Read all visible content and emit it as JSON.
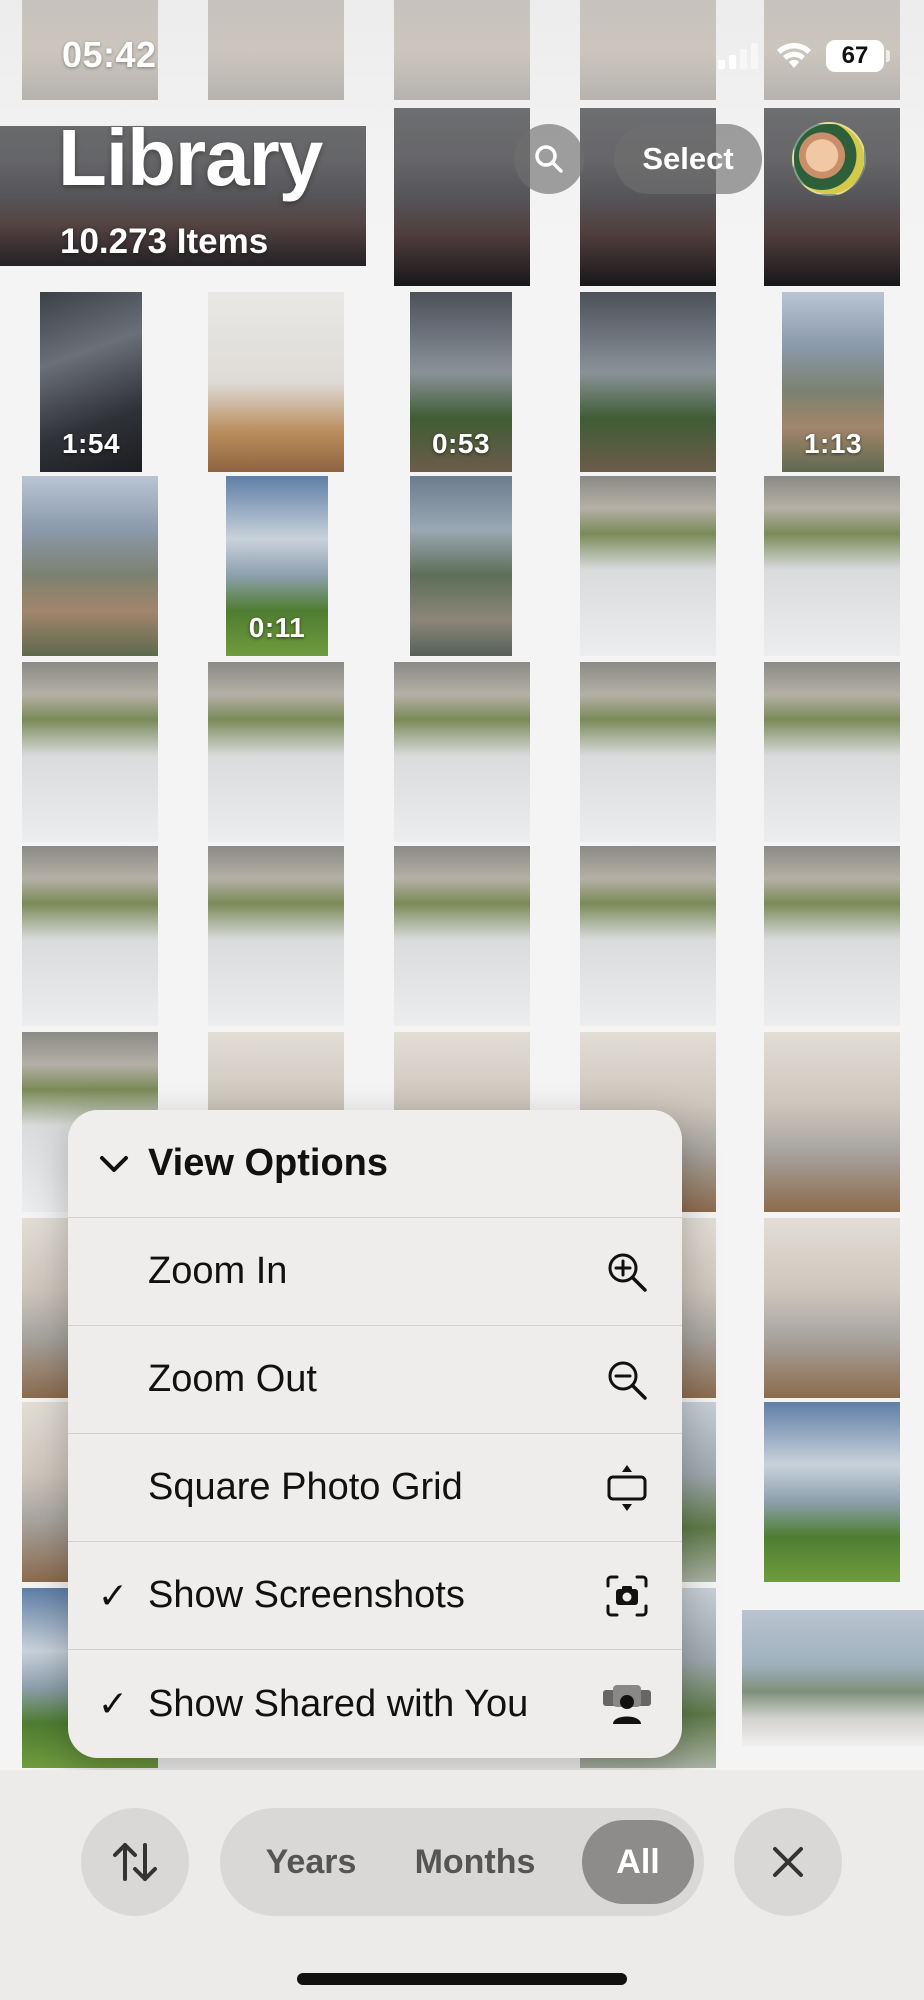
{
  "status_bar": {
    "time": "05:42",
    "battery": "67"
  },
  "header": {
    "title": "Library",
    "item_count": "10.273 Items",
    "select_label": "Select"
  },
  "grid": {
    "durations": [
      "1:54",
      "0:53",
      "1:13",
      "0:11"
    ]
  },
  "menu": {
    "title": "View Options",
    "items": [
      {
        "label": "Zoom In",
        "checked": "",
        "icon": "zoom-in-icon"
      },
      {
        "label": "Zoom Out",
        "checked": "",
        "icon": "zoom-out-icon"
      },
      {
        "label": "Square Photo Grid",
        "checked": "",
        "icon": "aspect-ratio-icon"
      },
      {
        "label": "Show Screenshots",
        "checked": "✓",
        "icon": "screenshot-icon"
      },
      {
        "label": "Show Shared with You",
        "checked": "✓",
        "icon": "shared-with-you-icon"
      }
    ]
  },
  "bottom_bar": {
    "segments": [
      "Years",
      "Months",
      "All"
    ],
    "active_segment": "All"
  }
}
